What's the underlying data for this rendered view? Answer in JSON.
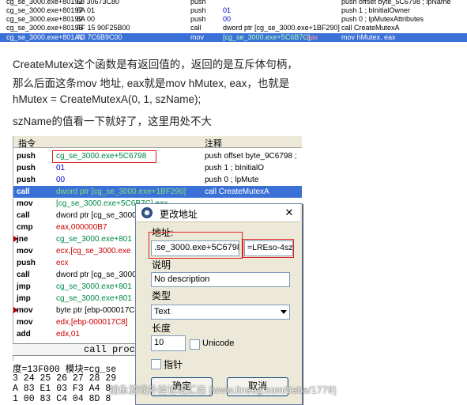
{
  "top_strip": {
    "rows": [
      {
        "addr": "cg_se_3000.exe+80192",
        "hex": "68 30673C80",
        "mnem": "push",
        "operand": "offset byte_5C6798 ; lpName",
        "comment": "push offset byte_5C6798 ; lpName"
      },
      {
        "addr": "cg_se_3000.exe+80197",
        "hex": "6A 01",
        "mnem": "push",
        "operand": "01",
        "comment": "push 1 ; bInitialOwner"
      },
      {
        "addr": "cg_se_3000.exe+80199",
        "hex": "6A 00",
        "mnem": "push",
        "operand": "00",
        "comment": "push 0 ; lpMutexAttributes"
      },
      {
        "addr": "cg_se_3000.exe+8019B",
        "hex": "FF 15 90F25B00",
        "mnem": "call",
        "operand": "dword ptr [cg_se_3000.exe+1BF290]",
        "comment": "call CreateMutexA"
      },
      {
        "addr": "cg_se_3000.exe+801A1",
        "hex": "A3 7C6B9C00",
        "mnem": "mov",
        "operand_prefix": "[cg_se_3000.exe+5C6B7C],",
        "operand_reg": "eax",
        "comment": "mov hMutex, eax"
      }
    ]
  },
  "article": {
    "line1": "CreateMutex这个函数是有返回值的，返回的是互斥体句柄，",
    "line2": "那么后面这条mov 地址, eax就是mov hMutex, eax，也就是",
    "line3": "hMutex = CreateMutexA(0, 1, szName);",
    "line4": "szName的值看一下就好了，这里用处不大"
  },
  "panel2": {
    "header_left": "指令",
    "header_right": "注释",
    "rows": [
      {
        "m": "push",
        "o": "cg_se_3000.exe+5C6798",
        "color": "green",
        "c": "push offset byte_9C6798 ;"
      },
      {
        "m": "push",
        "o": "01",
        "color": "blue",
        "c": "push    1       ; bInitialO"
      },
      {
        "m": "push",
        "o": "00",
        "color": "blue",
        "c": "push    0       ; lpMute"
      },
      {
        "m": "call",
        "o": "dword ptr [cg_se_3000.exe+1BF290]",
        "color": "green",
        "c": "call CreateMutexA"
      },
      {
        "m": "mov",
        "o": "[cg_se_3000.exe+5C6B7C],eax",
        "color": "green",
        "c": ""
      },
      {
        "m": "call",
        "o": "dword ptr [cg_se_3000.exe+",
        "color": "green",
        "c": ""
      },
      {
        "m": "cmp",
        "o": "eax,000000B7",
        "color": "red",
        "c": ""
      },
      {
        "m": "jne",
        "o": "cg_se_3000.exe+801",
        "color": "green",
        "c": ""
      },
      {
        "m": "mov",
        "o": "ecx,[cg_se_3000.exe",
        "color": "red",
        "c": ""
      },
      {
        "m": "push",
        "o": "ecx",
        "color": "red",
        "c": ""
      },
      {
        "m": "call",
        "o": "dword ptr [cg_se_3000.exe+",
        "color": "green",
        "c": ""
      },
      {
        "m": "jmp",
        "o": "cg_se_3000.exe+801",
        "color": "green",
        "c": ""
      },
      {
        "m": "jmp",
        "o": "cg_se_3000.exe+801",
        "color": "green",
        "c": ""
      },
      {
        "m": "mov",
        "o": "byte ptr [ebp-000017C",
        "color": "blue",
        "c": ""
      },
      {
        "m": "mov",
        "o": "edx,[ebp-000017C8]",
        "color": "red",
        "c": ""
      },
      {
        "m": "add",
        "o": "edx,01",
        "color": "red",
        "c": ""
      }
    ],
    "call_proc": "call proc",
    "status_line": "度=13F000 模块=cg_se",
    "hex_line1": "3 24 25 26 27 28 29",
    "hex_line2": "A 83 E1 03 F3 A4 8",
    "hex_line3": "1 00 83 C4 04 8D 8"
  },
  "dialog": {
    "title": "更改地址",
    "close": "✕",
    "address_label": "地址:",
    "address_value": ".se_3000.exe+5C6798",
    "address_side": "=LREso-4sz0",
    "desc_label": "说明",
    "desc_value": "No description",
    "type_label": "类型",
    "type_value": "Text",
    "length_label": "长度",
    "length_value": "10",
    "unicode_label": "Unicode",
    "pointer_label": "指针",
    "ok_label": "确定",
    "cancel_label": "取消"
  },
  "watermark": "捕鱼游戏外挂论坛汇出 [www.lineeg.com/tieba/1779]",
  "colors": {
    "selection": "#3b70d6",
    "operand_green": "#00884a",
    "operand_blue": "#0000cc",
    "operand_red": "#cc0000",
    "highlight_box": "#e02020"
  }
}
